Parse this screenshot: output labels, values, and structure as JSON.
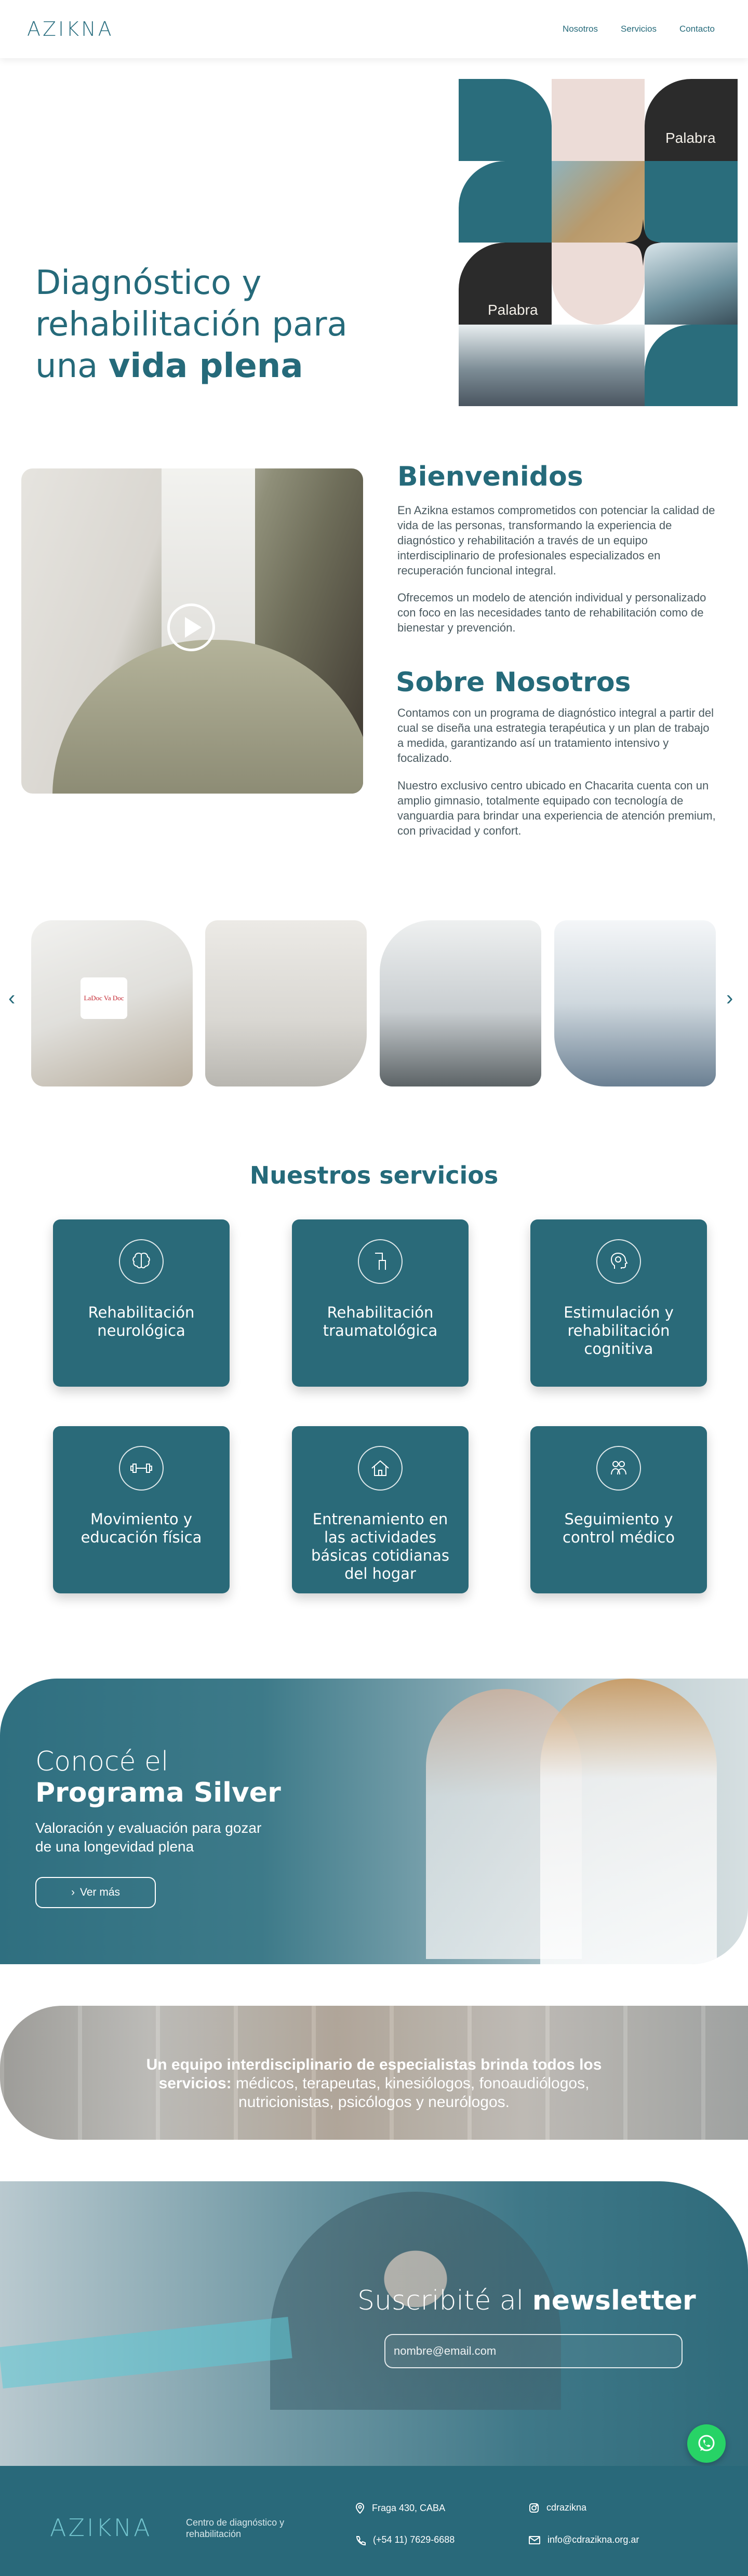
{
  "header": {
    "logo": "AZIKNA",
    "nav": [
      "Nosotros",
      "Servicios",
      "Contacto"
    ]
  },
  "hero": {
    "title_line1": "Diagnóstico y",
    "title_line2": "rehabilitación para",
    "title_line3_plain": "una ",
    "title_line3_bold": "vida plena",
    "tile_words": [
      "Palabra",
      "Palabra"
    ]
  },
  "welcome": {
    "title": "Bienvenidos",
    "p1": "En Azikna estamos comprometidos con potenciar la calidad de vida de las personas, transformando la experiencia de diagnóstico y rehabilitación a través de un equipo interdisciplinario de profesionales especializados en recuperación funcional integral.",
    "p2": "Ofrecemos un modelo de atención individual y personalizado con foco en las necesidades tanto de rehabilitación como de bienestar y prevención."
  },
  "about": {
    "title": "Sobre Nosotros",
    "p1": "Contamos con un programa de diagnóstico integral a partir del cual se diseña una estrategia terapéutica y un plan de trabajo a medida, garantizando así un tratamiento intensivo y focalizado.",
    "p2": "Nuestro exclusivo centro ubicado en Chacarita cuenta con un amplio gimnasio, totalmente equipado con tecnología de vanguardia para brindar una experiencia de atención premium, con privacidad y confort."
  },
  "gallery": {
    "badge_text": "LaDoc Va Doc"
  },
  "services": {
    "title": "Nuestros servicios",
    "items": [
      {
        "label": "Rehabilitación neurológica",
        "icon": "brain-icon"
      },
      {
        "label": "Rehabilitación traumatológica",
        "icon": "joint-icon"
      },
      {
        "label": "Estimulación y rehabilitación cognitiva",
        "icon": "head-mind-icon"
      },
      {
        "label": "Movimiento y educación física",
        "icon": "dumbbell-icon"
      },
      {
        "label": "Entrenamiento en las actividades básicas cotidianas del hogar",
        "icon": "home-icon"
      },
      {
        "label": "Seguimiento y control médico",
        "icon": "medical-team-icon"
      }
    ]
  },
  "silver": {
    "title_plain": "Conocé el",
    "title_bold": "Programa Silver",
    "subtitle": "Valoración y evaluación para gozar de una longevidad plena",
    "button": "Ver más"
  },
  "team": {
    "bold": "Un equipo interdisciplinario de especialistas brinda todos los servicios:",
    "rest": " médicos, terapeutas, kinesiólogos, fonoaudiólogos, nutricionistas, psicólogos y neurólogos."
  },
  "newsletter": {
    "title_plain": "Suscribité al ",
    "title_bold": "newsletter",
    "placeholder": "nombre@email.com"
  },
  "footer": {
    "logo": "AZIKNA",
    "tagline": "Centro de diagnóstico y rehabilitación",
    "address": "Fraga 430, CABA",
    "phone": "(+54 11) 7629-6688",
    "instagram": "cdrazikna",
    "email": "info@cdrazikna.org.ar"
  },
  "colors": {
    "brand_teal": "#256a7a",
    "card_teal": "#2a6a79",
    "accent_cyan": "#3a9aa9",
    "whatsapp": "#27d366"
  }
}
